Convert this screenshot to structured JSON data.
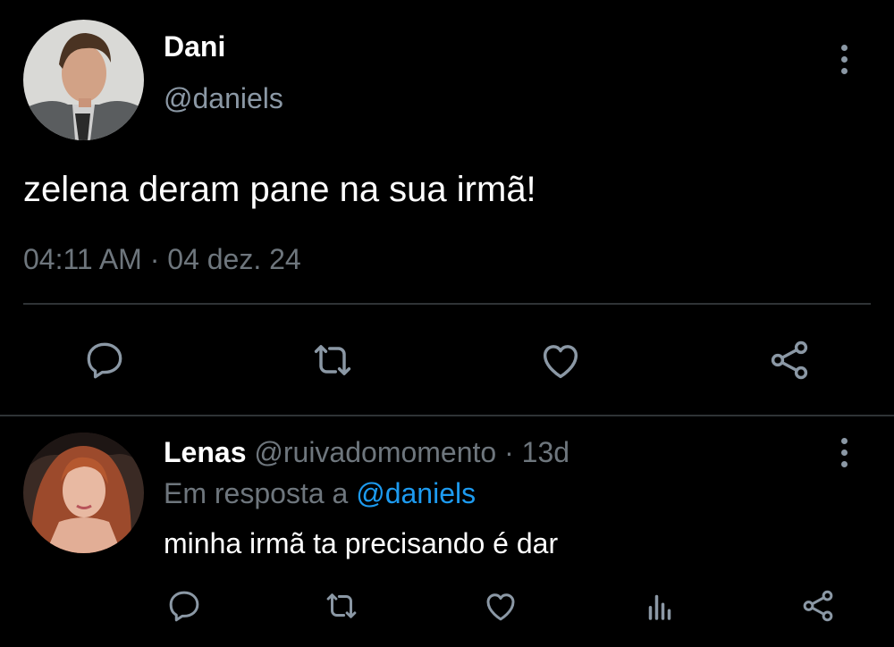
{
  "main_tweet": {
    "author_name": "Dani",
    "author_handle": "@daniels",
    "text": "zelena deram pane na sua irmã!",
    "meta": "04:11 AM · 04 dez. 24",
    "actions": [
      "reply-icon",
      "retweet-icon",
      "like-icon",
      "share-icon"
    ],
    "icons": {
      "menu": "more-vertical-icon"
    }
  },
  "reply": {
    "author_name": "Lenas",
    "author_handle": "@ruivadomomento",
    "separator": "·",
    "time": "13d",
    "reply_to_label": "Em resposta a",
    "reply_to_handle": "@daniels",
    "text": "minha irmã ta precisando é dar",
    "actions": [
      "reply-icon",
      "retweet-icon",
      "like-icon",
      "views-icon",
      "share-icon"
    ]
  },
  "colors": {
    "background": "#000000",
    "primary_text": "#ffffff",
    "secondary_text": "#6e767d",
    "link": "#1d9bf0",
    "divider": "#2f3336",
    "icon": "#8b98a5"
  }
}
